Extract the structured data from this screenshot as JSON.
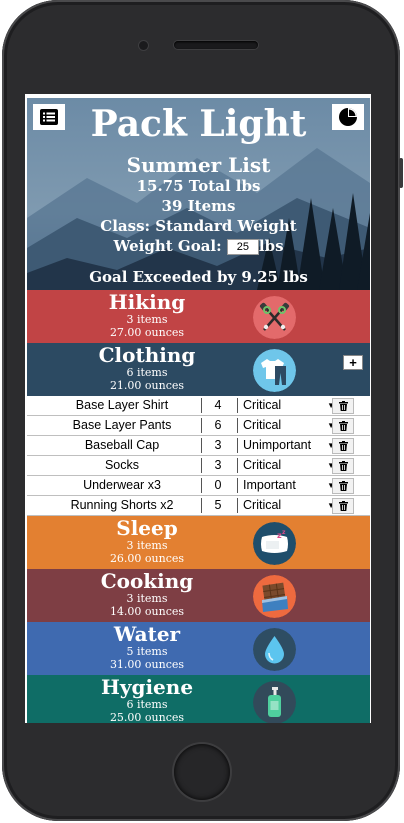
{
  "header": {
    "title": "Pack Light",
    "list_name": "Summer List",
    "total": "15.75 Total lbs",
    "items_count": "39 Items",
    "class_label": "Class: Standard Weight",
    "goal_label": "Weight Goal:",
    "goal_value": "25",
    "goal_unit": "lbs",
    "exceeded": "Goal Exceeded by 9.25 lbs"
  },
  "categories": [
    {
      "name": "Hiking",
      "items": "3 items",
      "ounces": "27.00 ounces",
      "color": "#c14445",
      "icon": "hiking-poles-icon"
    },
    {
      "name": "Clothing",
      "items": "6 items",
      "ounces": "21.00 ounces",
      "color": "#2c4a62",
      "icon": "clothing-icon",
      "add_label": "+"
    },
    {
      "name": "Sleep",
      "items": "3 items",
      "ounces": "26.00 ounces",
      "color": "#e38031",
      "icon": "pillow-icon"
    },
    {
      "name": "Cooking",
      "items": "3 items",
      "ounces": "14.00 ounces",
      "color": "#7e3e44",
      "icon": "chocolate-icon"
    },
    {
      "name": "Water",
      "items": "5 items",
      "ounces": "31.00 ounces",
      "color": "#3f6ab0",
      "icon": "water-drop-icon"
    },
    {
      "name": "Hygiene",
      "items": "6 items",
      "ounces": "25.00 ounces",
      "color": "#0f6d66",
      "icon": "soap-bottle-icon"
    }
  ],
  "clothing_items": [
    {
      "name": "Base Layer Shirt",
      "oz": "4",
      "priority": "Critical"
    },
    {
      "name": "Base Layer Pants",
      "oz": "6",
      "priority": "Critical"
    },
    {
      "name": "Baseball Cap",
      "oz": "3",
      "priority": "Unimportant"
    },
    {
      "name": "Socks",
      "oz": "3",
      "priority": "Critical"
    },
    {
      "name": "Underwear x3",
      "oz": "0",
      "priority": "Important"
    },
    {
      "name": "Running Shorts x2",
      "oz": "5",
      "priority": "Critical"
    }
  ]
}
